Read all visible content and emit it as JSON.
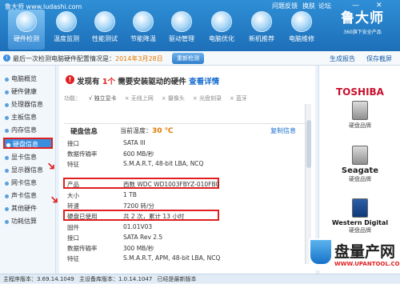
{
  "app": {
    "title": "鲁大师 www.ludashi.com"
  },
  "window_controls": [
    "问题反馈",
    "换肤",
    "论坛"
  ],
  "nav": [
    {
      "label": "硬件检测",
      "icon": "monitor-check-icon",
      "active": true
    },
    {
      "label": "温度监测",
      "icon": "thermometer-icon"
    },
    {
      "label": "性能测试",
      "icon": "speedometer-icon"
    },
    {
      "label": "节能降温",
      "icon": "leaf-icon"
    },
    {
      "label": "驱动管理",
      "icon": "driver-icon"
    },
    {
      "label": "电脑优化",
      "icon": "optimize-icon"
    },
    {
      "label": "新机推荐",
      "icon": "new-pc-icon"
    },
    {
      "label": "电脑维修",
      "icon": "repair-icon"
    }
  ],
  "brand": {
    "name": "鲁大师",
    "slogan": "360旗下安全产品"
  },
  "infobar": {
    "text": "最后一次检测电脑硬件配置情况是：",
    "date": "2014年3月28日",
    "recheck": "重新检测",
    "report": "生成报告",
    "save": "保存截屏"
  },
  "sidebar": [
    {
      "label": "电脑概览"
    },
    {
      "label": "硬件健康"
    },
    {
      "label": "处理器信息"
    },
    {
      "label": "主板信息"
    },
    {
      "label": "内存信息"
    },
    {
      "label": "硬盘信息",
      "active": true
    },
    {
      "label": "显卡信息"
    },
    {
      "label": "显示器信息"
    },
    {
      "label": "网卡信息"
    },
    {
      "label": "声卡信息"
    },
    {
      "label": "其他硬件"
    },
    {
      "label": "功耗估算"
    }
  ],
  "alert": {
    "pre": "发现有",
    "num": "1个",
    "mid": "需要安装驱动的硬件",
    "link": "查看详情"
  },
  "functions": {
    "label": "功能：",
    "items": [
      "√ 独立显卡",
      "× 无线上网",
      "× 摄像头",
      "× 光盘刻录",
      "× 蓝牙"
    ]
  },
  "disk": {
    "section_title": "硬盘信息",
    "temp_label": "当前温度：",
    "temp_value": "30 ℃",
    "copy": "复制信息",
    "rows_top": [
      {
        "k": "接口",
        "v": "SATA III"
      },
      {
        "k": "数据传输率",
        "v": "600 MB/秒"
      },
      {
        "k": "特征",
        "v": "S.M.A.R.T, 48-bit LBA, NCQ"
      }
    ],
    "rows_bottom": [
      {
        "k": "产品",
        "v": "西数 WDC WD1003FBYZ-010FB0"
      },
      {
        "k": "大小",
        "v": "1 TB"
      },
      {
        "k": "转速",
        "v": "7200 转/分"
      },
      {
        "k": "硬盘已使用",
        "v": "共 2 次，累计 13 小时"
      },
      {
        "k": "固件",
        "v": "01.01V03"
      },
      {
        "k": "接口",
        "v": "SATA Rev 2.5"
      },
      {
        "k": "数据传输率",
        "v": "300 MB/秒"
      },
      {
        "k": "特征",
        "v": "S.M.A.R.T, APM, 48-bit LBA, NCQ"
      }
    ]
  },
  "brands": [
    {
      "name": "TOSHIBA",
      "cap": "硬盘品牌"
    },
    {
      "name": "Seagate",
      "cap": "硬盘品牌"
    },
    {
      "name": "Western Digital",
      "cap": "硬盘品牌"
    }
  ],
  "status": {
    "main_version": "主程序版本：3.69.14.1049",
    "db_version": "主设备库版本：1.0.14.1047",
    "latest": "已经是最新版本"
  },
  "watermark": {
    "brand": "盘量产网",
    "url": "WWW.UPANTOOL.COM"
  }
}
